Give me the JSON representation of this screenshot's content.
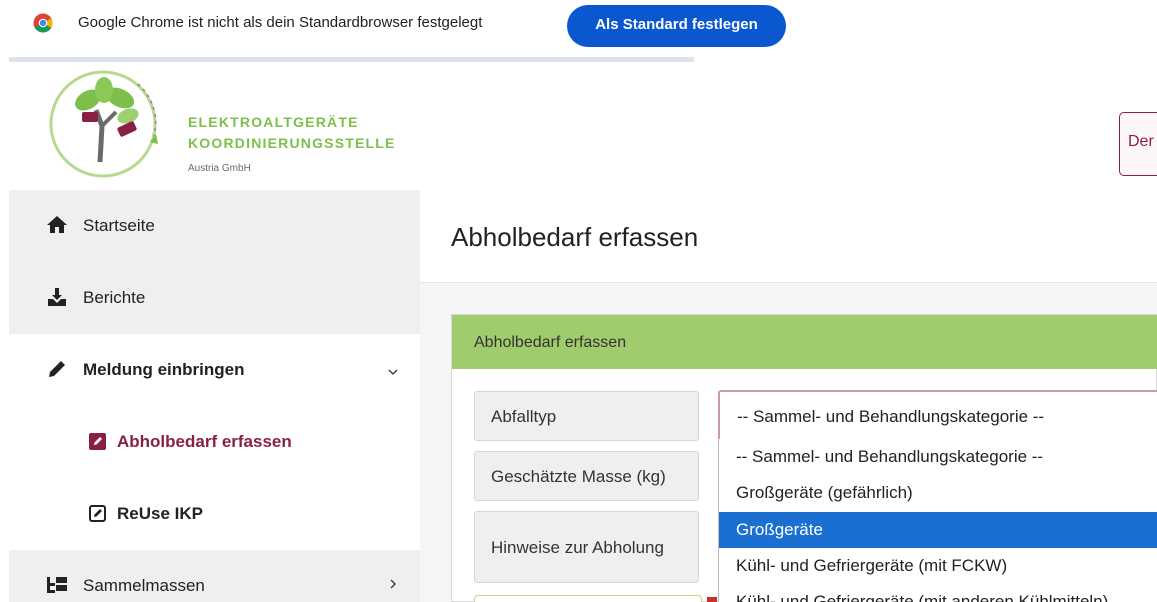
{
  "infobar": {
    "message": "Google Chrome ist nicht als dein Standardbrowser festgelegt",
    "button_label": "Als Standard festlegen",
    "icon": "chrome-icon"
  },
  "header": {
    "brand_line1": "ELEKTROALTGERÄTE",
    "brand_line2": "KOORDINIERUNGSSTELLE",
    "brand_line3": "Austria GmbH",
    "button_label": "Der",
    "logo": "eak-tree-logo"
  },
  "sidebar": {
    "items": [
      {
        "label": "Startseite",
        "icon": "home-icon"
      },
      {
        "label": "Berichte",
        "icon": "download-icon"
      },
      {
        "label": "Meldung einbringen",
        "icon": "pencil-icon",
        "expanded": true
      },
      {
        "label": "Abholbedarf erfassen",
        "icon": "edit-square-icon",
        "active": true
      },
      {
        "label": "ReUse IKP",
        "icon": "edit-square-outline-icon"
      },
      {
        "label": "Sammelmassen",
        "icon": "tree-structure-icon"
      }
    ]
  },
  "main": {
    "page_title": "Abholbedarf erfassen",
    "card_title": "Abholbedarf erfassen",
    "fields": {
      "abfalltyp_label": "Abfalltyp",
      "masse_label": "Geschätzte Masse (kg)",
      "hinweise_label": "Hinweise zur Abholung"
    },
    "select": {
      "value": "-- Sammel- und Behandlungskategorie --",
      "options": [
        "-- Sammel- und Behandlungskategorie --",
        "Großgeräte (gefährlich)",
        "Großgeräte",
        "Kühl- und Gefriergeräte (mit FCKW)",
        "Kühl- und Gefriergeräte (mit anderen Kühlmitteln)"
      ],
      "highlighted_index": 2
    }
  },
  "colors": {
    "accent": "#8a2045",
    "brand_green": "#7cc04b",
    "card_header": "#a1cc6d",
    "chrome_button": "#0b57d0",
    "highlight": "#1a6fd1"
  }
}
